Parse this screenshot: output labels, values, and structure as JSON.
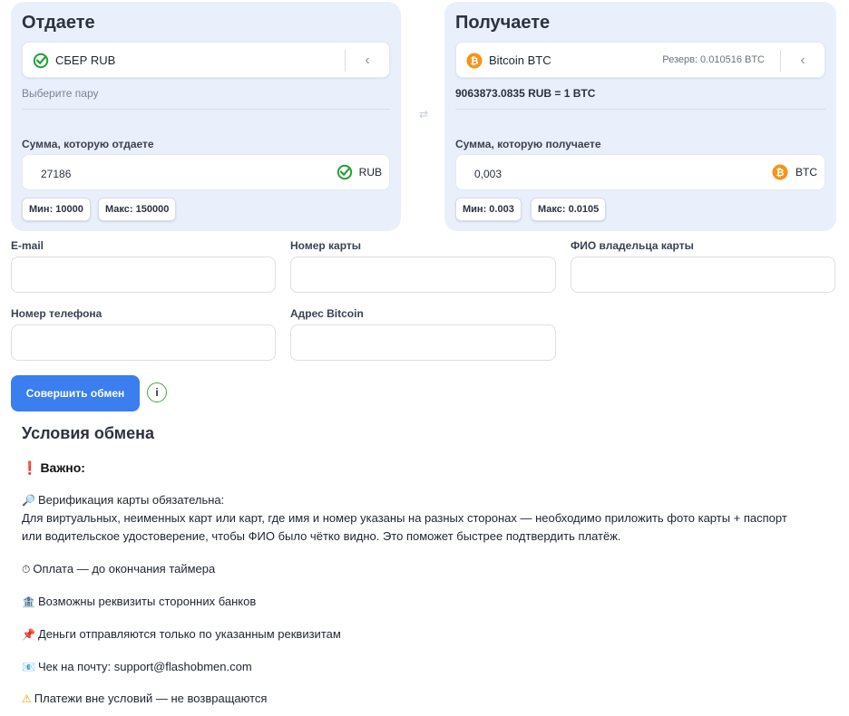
{
  "give": {
    "title": "Отдаете",
    "currency_name": "СБЕР RUB",
    "pair_hint": "Выберите пару",
    "amount_label": "Сумма, которую отдаете",
    "amount_value": "27186",
    "currency_code": "RUB",
    "min": "Мин: 10000",
    "max": "Макс: 150000"
  },
  "get": {
    "title": "Получаете",
    "currency_name": "Bitcoin BTC",
    "reserve": "Резерв: 0.010516 BTC",
    "rate": "9063873.0835 RUB = 1 BTC",
    "amount_label": "Сумма, которую получаете",
    "amount_value": "0,003",
    "currency_code": "BTC",
    "min": "Мин: 0.003",
    "max": "Макс: 0.0105"
  },
  "form": {
    "email_label": "E-mail",
    "card_label": "Номер карты",
    "holder_label": "ФИО владельца карты",
    "phone_label": "Номер телефона",
    "btc_address_label": "Адрес Bitcoin",
    "submit_label": "Совершить обмен",
    "info_label": "i"
  },
  "terms": {
    "title": "Условия обмена",
    "important": "Важно:",
    "verification_title": "Верификация карты обязательна:",
    "verification_line1": "Для виртуальных, неименных карт или карт, где имя и номер указаны на разных сторонах — необходимо приложить фото карты + паспорт",
    "verification_line2": "или водительское удостоверение, чтобы ФИО было чётко видно. Это поможет быстрее подтвердить платёж.",
    "payment_timer": "Оплата — до окончания таймера",
    "third_party_banks": "Возможны реквизиты сторонних банков",
    "money_sent": "Деньги отправляются только по указанным реквизитам",
    "receipt": "Чек на почту: support@flashobmen.com",
    "no_refund": "Платежи вне условий — не возвращаются"
  },
  "colors": {
    "panel_bg": "#eaf0fb",
    "accent": "#3b7ef0",
    "sber_green": "#21a038",
    "btc_orange": "#f7931a"
  },
  "icons": [
    "sber-logo-icon",
    "bitcoin-icon",
    "chevron-left-icon",
    "swap-icon",
    "info-icon",
    "exclamation-icon",
    "magnifier-icon",
    "stopwatch-icon",
    "bank-icon",
    "pushpin-icon",
    "envelope-icon",
    "warning-icon"
  ]
}
